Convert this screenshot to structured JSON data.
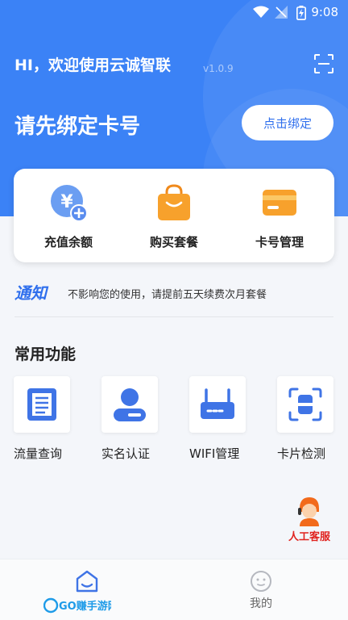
{
  "status_bar": {
    "time": "9:08"
  },
  "header": {
    "greeting": "HI，欢迎使用云诚智联",
    "version": "v1.0.9",
    "bind_title": "请先绑定卡号",
    "bind_button": "点击绑定"
  },
  "quick_actions": [
    {
      "label": "充值余额",
      "icon": "recharge-yen-icon"
    },
    {
      "label": "购买套餐",
      "icon": "shopping-bag-icon"
    },
    {
      "label": "卡号管理",
      "icon": "card-icon"
    }
  ],
  "notice": {
    "tag": "通知",
    "text": "不影响您的使用，请提前五天续费次月套餐"
  },
  "common_functions": {
    "title": "常用功能",
    "items": [
      {
        "label": "流量查询",
        "icon": "document-icon"
      },
      {
        "label": "实名认证",
        "icon": "user-icon"
      },
      {
        "label": "WIFI管理",
        "icon": "router-icon"
      },
      {
        "label": "卡片检测",
        "icon": "scan-card-icon"
      }
    ]
  },
  "customer_service": {
    "label": "人工客服",
    "icon": "service-agent-icon"
  },
  "tabbar": {
    "tabs": [
      {
        "label": "",
        "icon": "home-icon",
        "active": true
      },
      {
        "label": "我的",
        "icon": "profile-face-icon",
        "active": false
      }
    ]
  },
  "watermark": {
    "text": "GO赚手游网"
  },
  "colors": {
    "primary": "#3b82f6",
    "accent_text": "#2f6fed",
    "service_red": "#e0231f",
    "orange": "#f7a12c"
  }
}
